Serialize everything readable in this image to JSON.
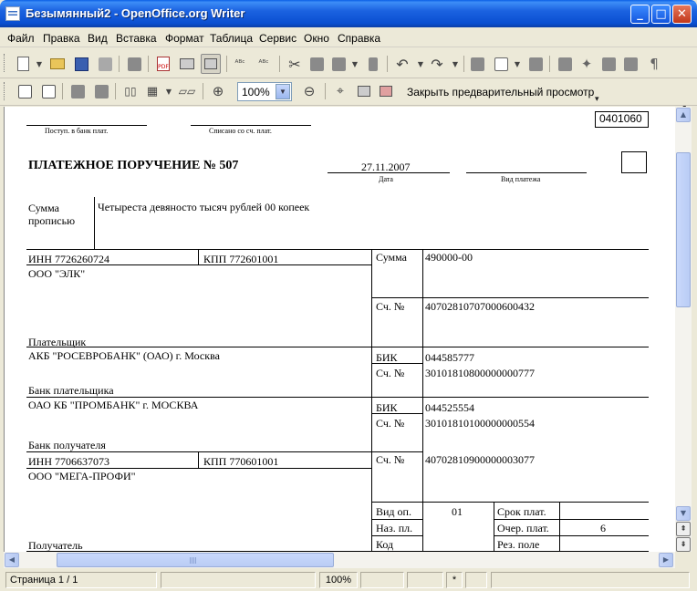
{
  "window": {
    "title": "Безымянный2 - OpenOffice.org Writer",
    "minimize": "_",
    "maximize": "□",
    "close": "✕"
  },
  "menu": [
    "Файл",
    "Правка",
    "Вид",
    "Вставка",
    "Формат",
    "Таблица",
    "Сервис",
    "Окно",
    "Справка"
  ],
  "toolbar2": {
    "zoom_value": "100%",
    "close_preview_label": "Закрыть предварительный просмотр"
  },
  "document": {
    "okud_code": "0401060",
    "received_label": "Поступ. в банк плат.",
    "debited_label": "Списано со сч. плат.",
    "title": "ПЛАТЕЖНОЕ ПОРУЧЕНИЕ № 507",
    "date_value": "27.11.2007",
    "date_label": "Дата",
    "payment_type_label": "Вид платежа",
    "amount_words_label_1": "Сумма",
    "amount_words_label_2": "прописью",
    "amount_words_value": "Четыреста девяносто тысяч рублей 00 копеек",
    "payer_inn": "ИНН 7726260724",
    "payer_kpp": "КПП 772601001",
    "amount_label": "Сумма",
    "amount_value": "490000-00",
    "payer_name": "ООО \"ЭЛК\"",
    "account_label": "Сч. №",
    "payer_account": "40702810707000600432",
    "payer_label": "Плательщик",
    "payer_bank_name": "АКБ \"РОСЕВРОБАНК\" (ОАО) г. Москва",
    "bik_label": "БИК",
    "payer_bank_bik": "044585777",
    "payer_bank_account": "30101810800000000777",
    "payer_bank_label": "Банк плательщика",
    "payee_bank_name": "ОАО КБ \"ПРОМБАНК\" г. МОСКВА",
    "payee_bank_bik": "044525554",
    "payee_bank_account": "30101810100000000554",
    "payee_bank_label": "Банк получателя",
    "payee_inn": "ИНН 7706637073",
    "payee_kpp": "КПП 770601001",
    "payee_account": "40702810900000003077",
    "payee_name": "ООО \"МЕГА-ПРОФИ\"",
    "op_type_label": "Вид оп.",
    "op_type_value": "01",
    "term_label": "Срок плат.",
    "purpose_code_label": "Наз. пл.",
    "priority_label": "Очер. плат.",
    "priority_value": "6",
    "code_label": "Код",
    "reserve_label": "Рез. поле",
    "payee_label": "Получатель"
  },
  "statusbar": {
    "page": "Страница  1 / 1",
    "zoom": "100%",
    "modified": "*"
  },
  "colors": {
    "titlebar": "#0a4fd1",
    "chrome": "#ece9d8",
    "close_button": "#c2381a"
  }
}
